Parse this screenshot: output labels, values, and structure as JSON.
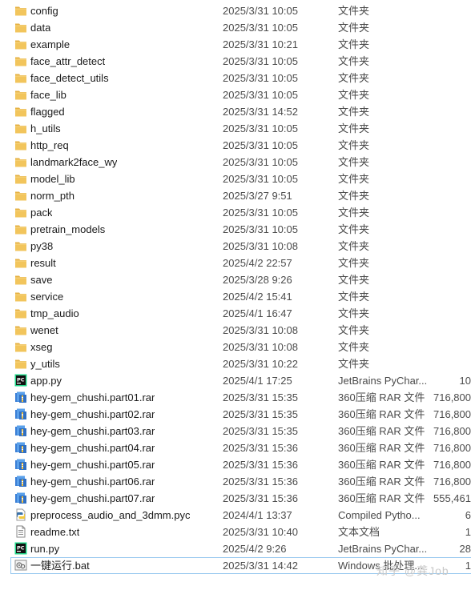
{
  "files": [
    {
      "name": "config",
      "date": "2025/3/31 10:05",
      "type": "文件夹",
      "size": "",
      "icon": "folder-icon"
    },
    {
      "name": "data",
      "date": "2025/3/31 10:05",
      "type": "文件夹",
      "size": "",
      "icon": "folder-icon"
    },
    {
      "name": "example",
      "date": "2025/3/31 10:21",
      "type": "文件夹",
      "size": "",
      "icon": "folder-icon"
    },
    {
      "name": "face_attr_detect",
      "date": "2025/3/31 10:05",
      "type": "文件夹",
      "size": "",
      "icon": "folder-icon"
    },
    {
      "name": "face_detect_utils",
      "date": "2025/3/31 10:05",
      "type": "文件夹",
      "size": "",
      "icon": "folder-icon"
    },
    {
      "name": "face_lib",
      "date": "2025/3/31 10:05",
      "type": "文件夹",
      "size": "",
      "icon": "folder-icon"
    },
    {
      "name": "flagged",
      "date": "2025/3/31 14:52",
      "type": "文件夹",
      "size": "",
      "icon": "folder-icon"
    },
    {
      "name": "h_utils",
      "date": "2025/3/31 10:05",
      "type": "文件夹",
      "size": "",
      "icon": "folder-icon"
    },
    {
      "name": "http_req",
      "date": "2025/3/31 10:05",
      "type": "文件夹",
      "size": "",
      "icon": "folder-icon"
    },
    {
      "name": "landmark2face_wy",
      "date": "2025/3/31 10:05",
      "type": "文件夹",
      "size": "",
      "icon": "folder-icon"
    },
    {
      "name": "model_lib",
      "date": "2025/3/31 10:05",
      "type": "文件夹",
      "size": "",
      "icon": "folder-icon"
    },
    {
      "name": "norm_pth",
      "date": "2025/3/27 9:51",
      "type": "文件夹",
      "size": "",
      "icon": "folder-icon"
    },
    {
      "name": "pack",
      "date": "2025/3/31 10:05",
      "type": "文件夹",
      "size": "",
      "icon": "folder-icon"
    },
    {
      "name": "pretrain_models",
      "date": "2025/3/31 10:05",
      "type": "文件夹",
      "size": "",
      "icon": "folder-icon"
    },
    {
      "name": "py38",
      "date": "2025/3/31 10:08",
      "type": "文件夹",
      "size": "",
      "icon": "folder-icon"
    },
    {
      "name": "result",
      "date": "2025/4/2 22:57",
      "type": "文件夹",
      "size": "",
      "icon": "folder-icon"
    },
    {
      "name": "save",
      "date": "2025/3/28 9:26",
      "type": "文件夹",
      "size": "",
      "icon": "folder-icon"
    },
    {
      "name": "service",
      "date": "2025/4/2 15:41",
      "type": "文件夹",
      "size": "",
      "icon": "folder-icon"
    },
    {
      "name": "tmp_audio",
      "date": "2025/4/1 16:47",
      "type": "文件夹",
      "size": "",
      "icon": "folder-icon"
    },
    {
      "name": "wenet",
      "date": "2025/3/31 10:08",
      "type": "文件夹",
      "size": "",
      "icon": "folder-icon"
    },
    {
      "name": "xseg",
      "date": "2025/3/31 10:08",
      "type": "文件夹",
      "size": "",
      "icon": "folder-icon"
    },
    {
      "name": "y_utils",
      "date": "2025/3/31 10:22",
      "type": "文件夹",
      "size": "",
      "icon": "folder-icon"
    },
    {
      "name": "app.py",
      "date": "2025/4/1 17:25",
      "type": "JetBrains PyChar...",
      "size": "10",
      "icon": "pycharm-icon"
    },
    {
      "name": "hey-gem_chushi.part01.rar",
      "date": "2025/3/31 15:35",
      "type": "360压缩 RAR 文件",
      "size": "716,800",
      "icon": "rar-archive-icon"
    },
    {
      "name": "hey-gem_chushi.part02.rar",
      "date": "2025/3/31 15:35",
      "type": "360压缩 RAR 文件",
      "size": "716,800",
      "icon": "rar-archive-icon"
    },
    {
      "name": "hey-gem_chushi.part03.rar",
      "date": "2025/3/31 15:35",
      "type": "360压缩 RAR 文件",
      "size": "716,800",
      "icon": "rar-archive-icon"
    },
    {
      "name": "hey-gem_chushi.part04.rar",
      "date": "2025/3/31 15:36",
      "type": "360压缩 RAR 文件",
      "size": "716,800",
      "icon": "rar-archive-icon"
    },
    {
      "name": "hey-gem_chushi.part05.rar",
      "date": "2025/3/31 15:36",
      "type": "360压缩 RAR 文件",
      "size": "716,800",
      "icon": "rar-archive-icon"
    },
    {
      "name": "hey-gem_chushi.part06.rar",
      "date": "2025/3/31 15:36",
      "type": "360压缩 RAR 文件",
      "size": "716,800",
      "icon": "rar-archive-icon"
    },
    {
      "name": "hey-gem_chushi.part07.rar",
      "date": "2025/3/31 15:36",
      "type": "360压缩 RAR 文件",
      "size": "555,461",
      "icon": "rar-archive-icon"
    },
    {
      "name": "preprocess_audio_and_3dmm.pyc",
      "date": "2024/4/1 13:37",
      "type": "Compiled Pytho...",
      "size": "6",
      "icon": "python-compiled-icon"
    },
    {
      "name": "readme.txt",
      "date": "2025/3/31 10:40",
      "type": "文本文档",
      "size": "1",
      "icon": "text-file-icon"
    },
    {
      "name": "run.py",
      "date": "2025/4/2 9:26",
      "type": "JetBrains PyChar...",
      "size": "28",
      "icon": "pycharm-icon"
    },
    {
      "name": "一键运行.bat",
      "date": "2025/3/31 14:42",
      "type": "Windows 批处理...",
      "size": "1",
      "icon": "batch-file-icon",
      "selected": true
    }
  ],
  "watermark": "知乎 @龚Job",
  "colors": {
    "folder": "#f2c55c",
    "selection_border": "#99c9ef",
    "pycharm_bg": "#111111"
  }
}
